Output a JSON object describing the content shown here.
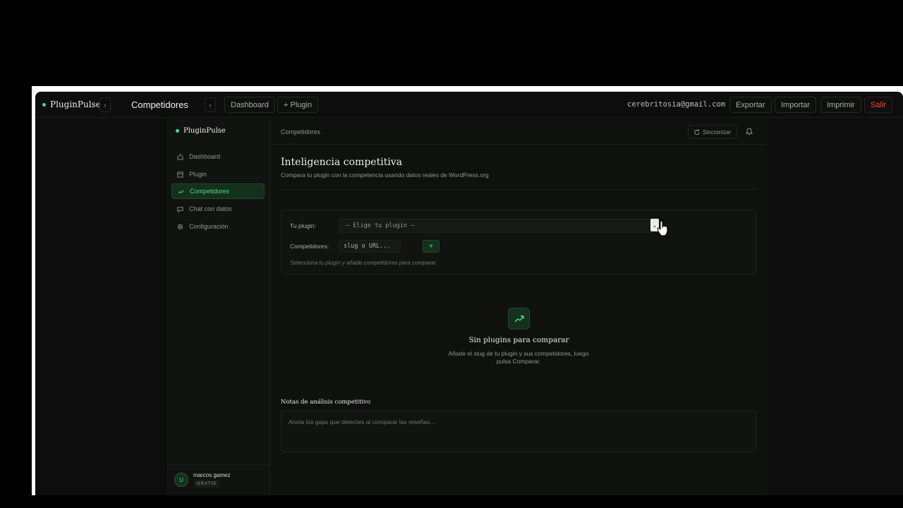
{
  "topbar": {
    "brand": "PluginPulse",
    "prev_label": "‹",
    "next_label": "›",
    "title": "Competidores",
    "dashboard_label": "Dashboard",
    "plugin_label": "+ Plugin",
    "email": "cerebritosia@gmail.com",
    "export_label": "Exportar",
    "import_label": "Importar",
    "print_label": "Imprimir",
    "logout_label": "Salir"
  },
  "sidebar": {
    "brand": "PluginPulse",
    "items": [
      {
        "label": "Dashboard",
        "icon": "home-icon"
      },
      {
        "label": "Plugin",
        "icon": "box-icon"
      },
      {
        "label": "Competidores",
        "icon": "trend-icon",
        "active": true
      },
      {
        "label": "Chat con datos",
        "icon": "chat-icon"
      },
      {
        "label": "Configuración",
        "icon": "gear-icon"
      }
    ],
    "user": {
      "initial": "U",
      "name": "marcos gamez",
      "plan": "GRATIS"
    }
  },
  "main": {
    "breadcrumb": "Competidores",
    "sync_label": "Sincronizar",
    "title": "Inteligencia competitiva",
    "subtitle": "Compara tu plugin con la competencia usando datos reales de WordPress.org",
    "form": {
      "plugin_label": "Tu plugin:",
      "plugin_placeholder": "— Elige tu plugin —",
      "competitors_label": "Competidores:",
      "competitors_placeholder": "slug o URL...",
      "add_label": "+",
      "hint": "Selecciona tu plugin y añade competidores para comparar."
    },
    "empty": {
      "title": "Sin plugins para comparar",
      "description": "Añade el slug de tu plugin y sus competidores, luego pulsa Comparar."
    },
    "notes": {
      "label": "Notas de análisis competitivo",
      "placeholder": "Anota los gaps que detectes al comparar las reseñas..."
    }
  },
  "colors": {
    "accent": "#4ade80",
    "danger": "#ef4444",
    "background": "#0c0d0c"
  }
}
